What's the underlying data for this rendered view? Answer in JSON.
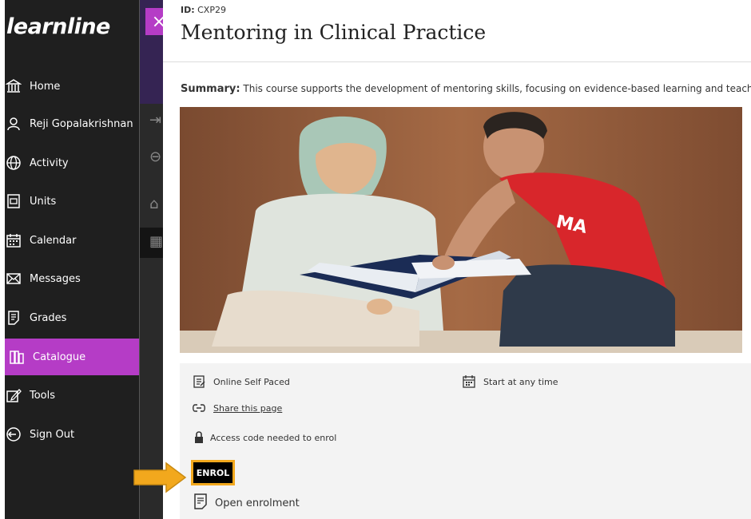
{
  "sidebar": {
    "logo": "learnline",
    "items": [
      {
        "label": "Home",
        "icon": "home-icon"
      },
      {
        "label": "Reji Gopalakrishnan",
        "icon": "user-icon"
      },
      {
        "label": "Activity",
        "icon": "globe-icon"
      },
      {
        "label": "Units",
        "icon": "units-icon"
      },
      {
        "label": "Calendar",
        "icon": "calendar-icon"
      },
      {
        "label": "Messages",
        "icon": "envelope-icon"
      },
      {
        "label": "Grades",
        "icon": "grades-icon"
      },
      {
        "label": "Catalogue",
        "icon": "catalogue-icon"
      },
      {
        "label": "Tools",
        "icon": "tools-icon"
      },
      {
        "label": "Sign Out",
        "icon": "sign-out-icon"
      }
    ],
    "active": "Catalogue"
  },
  "panel": {
    "close_label": "×",
    "id_label": "ID:",
    "id_value": "CXP29",
    "title": "Mentoring in Clinical Practice",
    "summary_label": "Summary:",
    "summary_text": "This course supports the development of mentoring skills, focusing on evidence-based learning and teaching p"
  },
  "details": {
    "mode": "Online Self Paced",
    "start": "Start at any time",
    "share": "Share this page",
    "access": "Access code needed to enrol",
    "enrol_button": "ENROL",
    "enrolment": "Open enrolment"
  },
  "colors": {
    "accent": "#b53cc6",
    "sidebar_bg": "#1f1f1f",
    "highlight": "#f2a81d"
  }
}
